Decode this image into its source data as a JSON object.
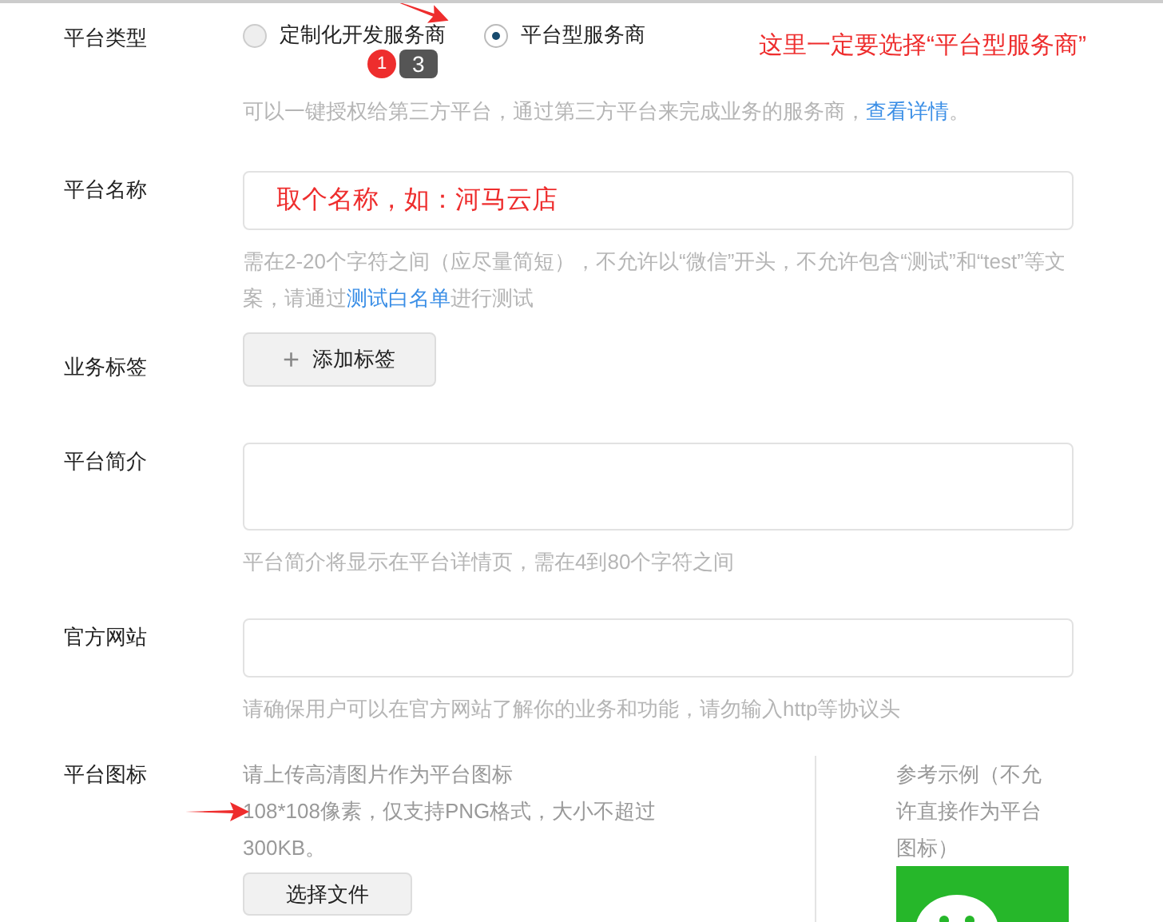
{
  "fields": [
    {
      "kind": "radio",
      "label": "平台类型",
      "options": [
        {
          "label": "定制化开发服务商",
          "selected": false
        },
        {
          "label": "平台型服务商",
          "selected": true
        }
      ],
      "hint": "可以一键授权给第三方平台，通过第三方平台来完成业务的服务商，",
      "hint_link": "查看详情",
      "hint_end": "。",
      "annotation": "这里一定要选择“平台型服务商”",
      "tooltip": {
        "badge": "1",
        "text": "3"
      }
    },
    {
      "kind": "input",
      "label": "平台名称",
      "value": "取个名称，如：河马云店",
      "hint": "需在2-20个字符之间（应尽量简短），不允许以“微信”开头，不允许包含“测试”和“test”等文案，请通过",
      "hint_link": "测试白名单",
      "hint_end": "进行测试"
    },
    {
      "kind": "tag",
      "label": "业务标签",
      "button": "添加标签",
      "icon": "+"
    },
    {
      "kind": "textarea",
      "label": "平台简介",
      "hint": "平台简介将显示在平台详情页，需在4到80个字符之间"
    },
    {
      "kind": "input",
      "label": "官方网站",
      "hint": "请确保用户可以在官方网站了解你的业务和功能，请勿输入http等协议头"
    },
    {
      "kind": "upload",
      "label": "平台图标",
      "lines": [
        "请上传高清图片作为平台图标",
        "108*108像素，仅支持PNG格式，大小不超过300KB。"
      ],
      "button": "选择文件",
      "example": "参考示例（不允许直接作为平台图标）"
    }
  ]
}
